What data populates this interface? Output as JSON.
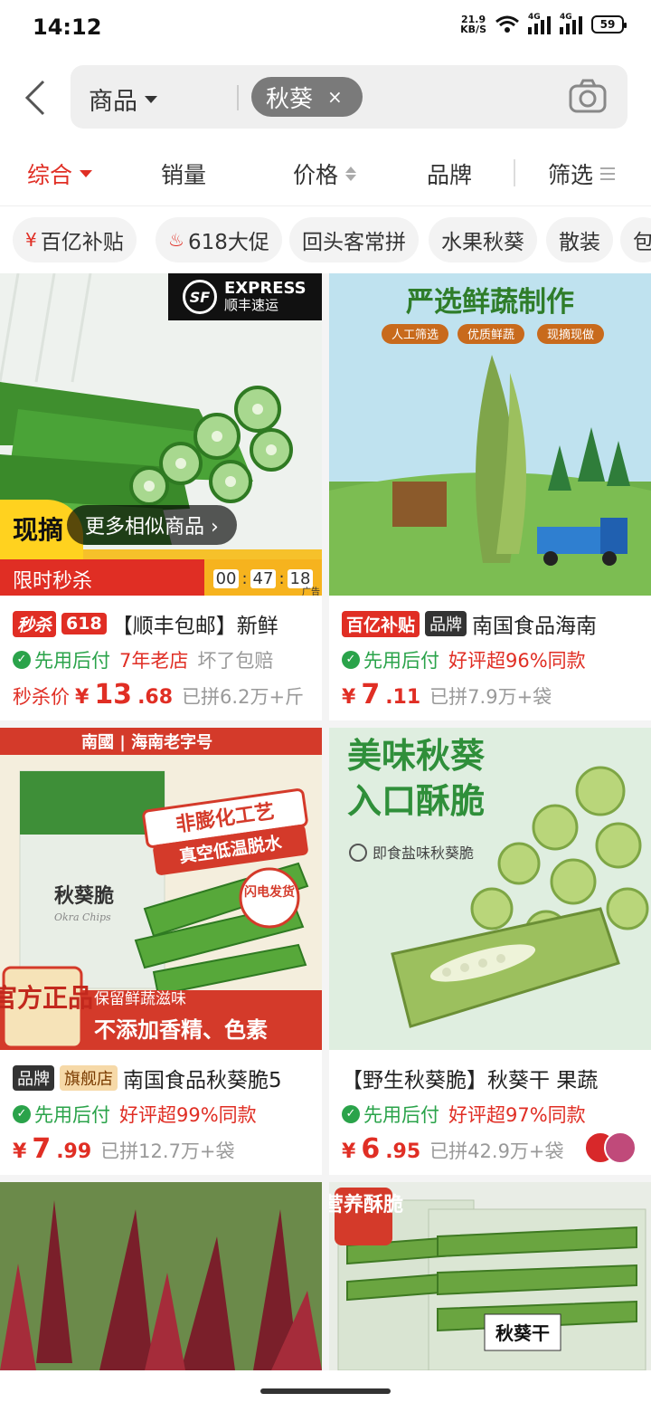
{
  "status": {
    "time": "14:12",
    "net_speed_top": "21.9",
    "net_speed_bottom": "KB/S",
    "sig1": "4G",
    "sig2": "4G",
    "battery": "59"
  },
  "search": {
    "scope": "商品",
    "query_chip": "秋葵",
    "chip_close": "×"
  },
  "sort": {
    "items": [
      "综合",
      "销量",
      "价格",
      "品牌",
      "筛选"
    ]
  },
  "tags": [
    {
      "label": "百亿补贴",
      "icon": "¥"
    },
    {
      "label": "618大促",
      "icon": "♨"
    },
    {
      "label": "回头客常拼"
    },
    {
      "label": "水果秋葵"
    },
    {
      "label": "散装"
    },
    {
      "label": "包"
    }
  ],
  "colors": {
    "accent": "#e02e24",
    "green": "#2aa34a",
    "flash_timer": "#f6b31e"
  },
  "products": [
    {
      "badges": [
        "秒杀",
        "618"
      ],
      "title": "【顺丰包邮】新鲜",
      "guarantee": "先用后付",
      "tag1": "7年老店",
      "tag2": "坏了包赔",
      "price_prefix": "秒杀价",
      "price_yen": "¥",
      "price_int": "13",
      "price_dec": ".68",
      "sold": "已拼6.2万+斤",
      "img_overlay": {
        "sf_badge": "SF",
        "sf_line1": "EXPRESS",
        "sf_line2": "顺丰速运",
        "xianzhai": "现摘",
        "similar": "更多相似商品 ›",
        "flash": "限时秒杀",
        "timer": [
          "00",
          "47",
          "18"
        ],
        "ad": "广告"
      }
    },
    {
      "badges": [
        "百亿补贴",
        "品牌"
      ],
      "title": "南国食品海南",
      "guarantee": "先用后付",
      "tag1": "好评超96%同款",
      "price_yen": "¥",
      "price_int": "7",
      "price_dec": ".11",
      "sold": "已拼7.9万+袋",
      "img_overlay": {
        "headline": "严选鲜蔬制作",
        "pills": [
          "人工筛选",
          "优质鲜蔬",
          "现摘现做"
        ]
      }
    },
    {
      "badges": [
        "品牌",
        "旗舰店"
      ],
      "title": "南国食品秋葵脆5",
      "guarantee": "先用后付",
      "tag1": "好评超99%同款",
      "price_yen": "¥",
      "price_int": "7",
      "price_dec": ".99",
      "sold": "已拼12.7万+袋",
      "img_overlay": {
        "brand_bar": "南國 | 海南老字号",
        "slogan1": "非膨化工艺",
        "slogan2": "真空低温脱水",
        "flash_ship": "闪电发货",
        "pack_name": "秋葵脆",
        "pack_en": "Okra Chips",
        "official": "官方正品",
        "keep": "保留鲜蔬滋味",
        "no_add": "不添加香精、色素"
      }
    },
    {
      "badges": [],
      "title": "【野生秋葵脆】秋葵干 果蔬",
      "guarantee": "先用后付",
      "tag1": "好评超97%同款",
      "price_yen": "¥",
      "price_int": "6",
      "price_dec": ".95",
      "sold": "已拼42.9万+袋",
      "img_overlay": {
        "headline1": "美味秋葵",
        "headline2": "入口酥脆",
        "sub": "即食盐味秋葵脆"
      }
    },
    {
      "img_overlay": {}
    },
    {
      "img_overlay": {
        "tag": "营养酥脆",
        "label": "秋葵干"
      }
    }
  ]
}
